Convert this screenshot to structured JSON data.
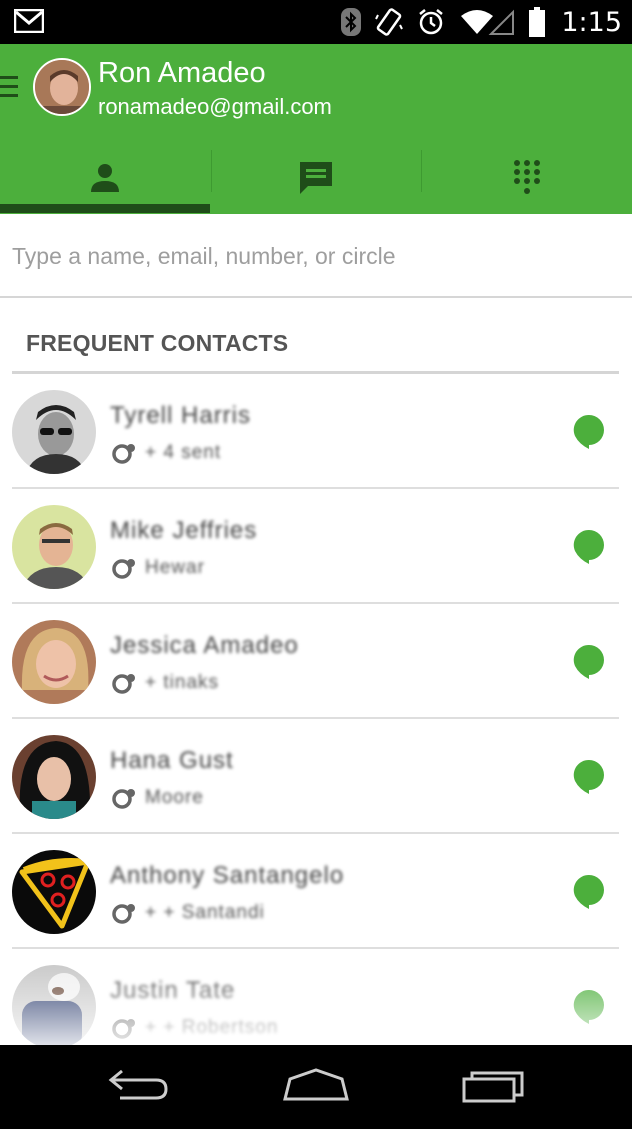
{
  "statusbar": {
    "time": "1:15",
    "icons": [
      "gmail-icon",
      "bluetooth-icon",
      "vibrate-icon",
      "alarm-icon",
      "wifi-icon",
      "cell-signal-icon",
      "battery-icon"
    ]
  },
  "account": {
    "name": "Ron Amadeo",
    "email": "ronamadeo@gmail.com"
  },
  "tabs": [
    {
      "icon": "person-icon",
      "selected": true
    },
    {
      "icon": "message-icon",
      "selected": false
    },
    {
      "icon": "dialpad-icon",
      "selected": false
    }
  ],
  "search": {
    "placeholder": "Type a name, email, number, or circle",
    "value": ""
  },
  "section": {
    "title": "FREQUENT CONTACTS"
  },
  "contacts": [
    {
      "name": "Tyrell Harris",
      "sub": "+ 4 sent",
      "online": true
    },
    {
      "name": "Mike Jeffries",
      "sub": "Hewar",
      "online": true
    },
    {
      "name": "Jessica Amadeo",
      "sub": "+ tinaks",
      "online": true
    },
    {
      "name": "Hana Gust",
      "sub": "Moore",
      "online": true
    },
    {
      "name": "Anthony Santangelo",
      "sub": "+ + Santandi",
      "online": true
    },
    {
      "name": "Justin Tate",
      "sub": "+ + Robertson",
      "online": true
    }
  ],
  "colors": {
    "appbar": "#4caf3c",
    "tab_indicator": "#1f4d19",
    "icon_dark": "#1f4d19",
    "chat_bubble": "#4caf3c",
    "statusbar": "#000000"
  },
  "navbar": {
    "buttons": [
      "back-icon",
      "home-icon",
      "recents-icon"
    ]
  }
}
